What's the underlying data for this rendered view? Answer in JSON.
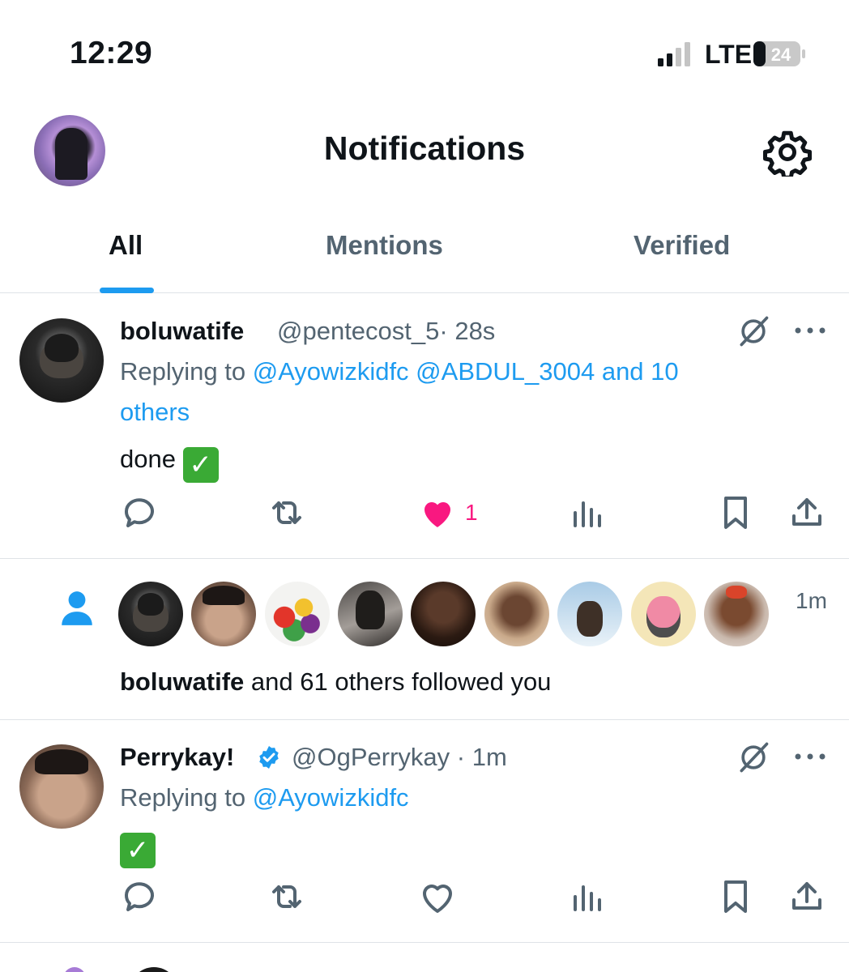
{
  "status_bar": {
    "time": "12:29",
    "network": "LTE",
    "battery": "24"
  },
  "header": {
    "title": "Notifications"
  },
  "tabs": [
    {
      "label": "All",
      "active": true
    },
    {
      "label": "Mentions",
      "active": false
    },
    {
      "label": "Verified",
      "active": false
    }
  ],
  "notifications": [
    {
      "type": "reply",
      "name": "boluwatife",
      "handle": "@pentecost_5",
      "time": "· 28s",
      "replying_prefix": "Replying to ",
      "replying_links": "@Ayowizkidfc @ABDUL_3004 and 10",
      "replying_links_2": "others",
      "body": "done",
      "like_count": "1",
      "liked": true
    },
    {
      "type": "follow",
      "time": "1m",
      "who": "boluwatife",
      "rest": " and 61 others followed you",
      "avatars": [
        "monkey",
        "baby",
        "fruit",
        "hood",
        "boy",
        "boy2",
        "sky",
        "bear",
        "man"
      ]
    },
    {
      "type": "reply",
      "name": "Perrykay!",
      "handle": "@OgPerrykay",
      "time": "· 1m",
      "replying_prefix": "Replying to ",
      "replying_links": "@Ayowizkidfc",
      "body": "",
      "verified": true,
      "liked": false
    }
  ],
  "colors": {
    "accent": "#1d9bf0",
    "like": "#f91880",
    "muted": "#536471",
    "check": "#3aaa35"
  }
}
